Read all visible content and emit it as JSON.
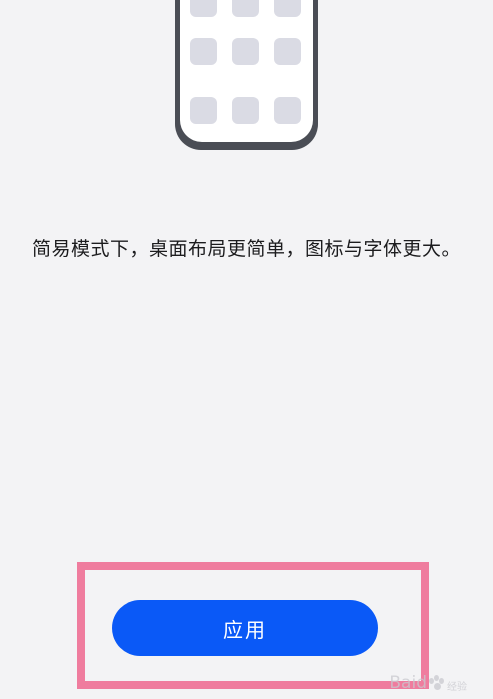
{
  "description": "简易模式下，桌面布局更简单，图标与字体更大。",
  "apply_button": {
    "label": "应用"
  },
  "watermark": {
    "text": "Baid",
    "suffix": "经验"
  },
  "colors": {
    "background": "#f3f3f5",
    "accent": "#0a59f7",
    "highlight": "#ef7c9e",
    "phone_frame": "#4a4d55",
    "app_icon": "#dadbe4"
  }
}
